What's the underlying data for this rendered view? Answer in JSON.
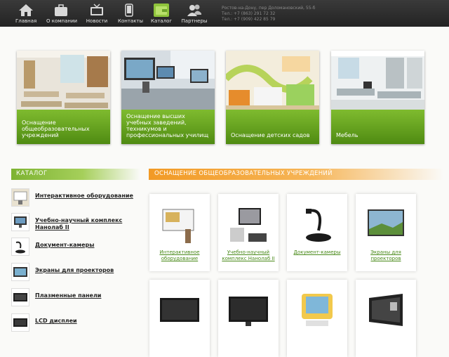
{
  "nav": [
    {
      "label": "Главная",
      "icon": "home-icon"
    },
    {
      "label": "О компании",
      "icon": "briefcase-icon"
    },
    {
      "label": "Новости",
      "icon": "tv-icon"
    },
    {
      "label": "Контакты",
      "icon": "phone-icon"
    },
    {
      "label": "Каталог",
      "icon": "wallet-icon"
    },
    {
      "label": "Партнеры",
      "icon": "people-icon"
    }
  ],
  "contacts": {
    "address": "Ростов-на-Дону, пер Доломановский, 55-б",
    "phone1": "Тел.: +7 (863) 291 72 32",
    "phone2": "Тел.: +7 (909) 422 85 79"
  },
  "categories": [
    {
      "title": "Оснащение общеобразовательных учреждений"
    },
    {
      "title": "Оснащение высших учебных заведений, техникумов и профессиональных училищ"
    },
    {
      "title": "Оснащение детских садов"
    },
    {
      "title": "Мебель"
    }
  ],
  "sidebar": {
    "heading": "КАТАЛОГ",
    "items": [
      {
        "label": "Интерактивное оборудование"
      },
      {
        "label": "Учебно-научный комплекс Нанолаб II"
      },
      {
        "label": "Документ-камеры"
      },
      {
        "label": "Экраны для проекторов"
      },
      {
        "label": "Плазменные панели"
      },
      {
        "label": "LCD дисплеи"
      }
    ]
  },
  "section": {
    "heading": "ОСНАЩЕНИЕ ОБЩЕОБРАЗОВАТЕЛЬНЫХ УЧРЕЖДЕНИЙ",
    "products": [
      {
        "label": "Интерактивное оборудование"
      },
      {
        "label": "Учебно-научный комплекс Нанолаб II"
      },
      {
        "label": "Документ-камеры"
      },
      {
        "label": "Экраны для проекторов"
      },
      {
        "label": ""
      },
      {
        "label": ""
      },
      {
        "label": ""
      },
      {
        "label": ""
      }
    ]
  },
  "colors": {
    "accent_green": "#7fbb2f",
    "accent_orange": "#f29a25",
    "topbar": "#2c2c2c"
  }
}
